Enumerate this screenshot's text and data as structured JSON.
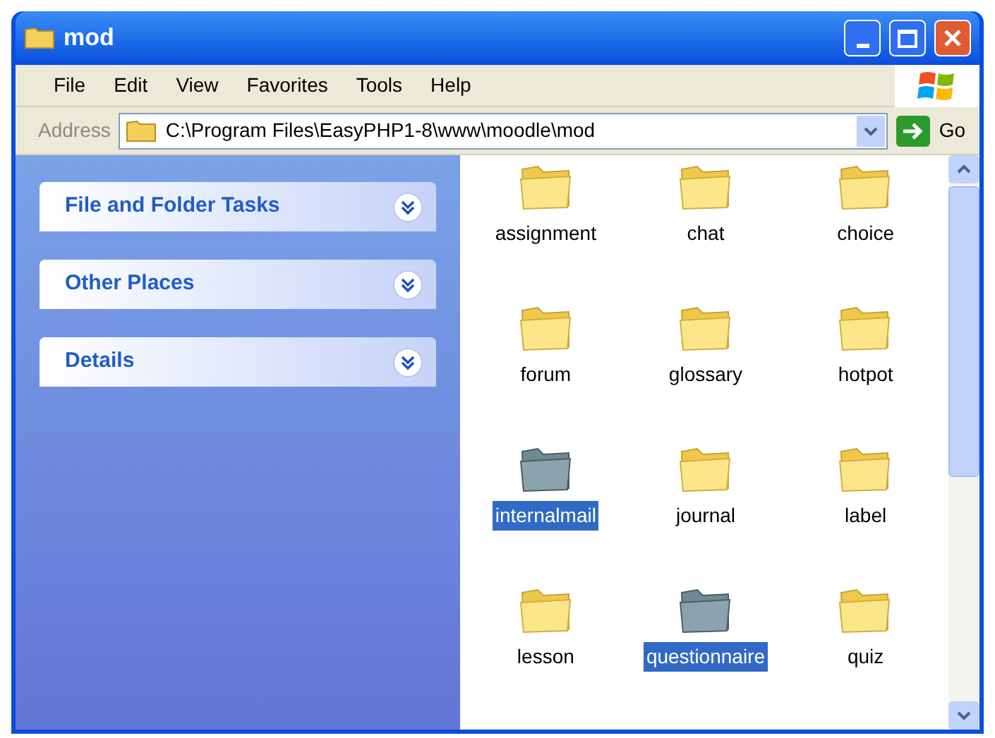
{
  "window": {
    "title": "mod"
  },
  "menu": [
    "File",
    "Edit",
    "View",
    "Favorites",
    "Tools",
    "Help"
  ],
  "address_bar": {
    "label": "Address",
    "value": "C:\\Program Files\\EasyPHP1-8\\www\\moodle\\mod",
    "go": "Go"
  },
  "task_panes": [
    {
      "title": "File and Folder Tasks",
      "expanded": false
    },
    {
      "title": "Other Places",
      "expanded": false
    },
    {
      "title": "Details",
      "expanded": false
    }
  ],
  "folders": [
    {
      "name": "assignment",
      "selected": false
    },
    {
      "name": "chat",
      "selected": false
    },
    {
      "name": "choice",
      "selected": false
    },
    {
      "name": "forum",
      "selected": false
    },
    {
      "name": "glossary",
      "selected": false
    },
    {
      "name": "hotpot",
      "selected": false
    },
    {
      "name": "internalmail",
      "selected": true
    },
    {
      "name": "journal",
      "selected": false
    },
    {
      "name": "label",
      "selected": false
    },
    {
      "name": "lesson",
      "selected": false
    },
    {
      "name": "questionnaire",
      "selected": true
    },
    {
      "name": "quiz",
      "selected": false
    }
  ]
}
